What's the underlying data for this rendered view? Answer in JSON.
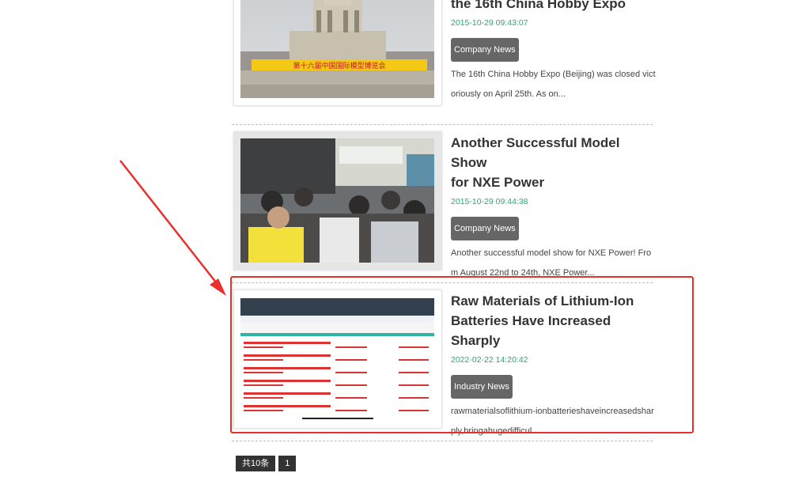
{
  "articles": [
    {
      "title_line1": "",
      "title_line2": "the 16th China Hobby Expo",
      "date": "2015-10-29 09:43:07",
      "tag": "Company News",
      "summary": "The 16th China Hobby Expo (Beijing) was closed victoriously on April 25th. As on..."
    },
    {
      "title_line1": "Another Successful Model Show",
      "title_line2": "for NXE Power",
      "date": "2015-10-29 09:44:38",
      "tag": "Company News",
      "summary": "Another successful model show for NXE Power! From August 22nd to 24th, NXE Power..."
    },
    {
      "title_line1": "Raw Materials of Lithium-Ion",
      "title_line2": "Batteries Have Increased Sharply",
      "date": "2022-02-22 14:20:42",
      "tag": "Industry News",
      "summary": "rawmaterialsoflithium-ionbatterieshaveincreasedsharply,bringahugedifficul"
    }
  ],
  "pager": {
    "total": "共10条",
    "page": "1"
  },
  "images": {
    "expo_banner_text": "第十六届中国国际模型博览会"
  },
  "colors": {
    "date_green": "#2ea86f",
    "tag_bg": "#666666",
    "highlight_red": "#e8302c"
  }
}
